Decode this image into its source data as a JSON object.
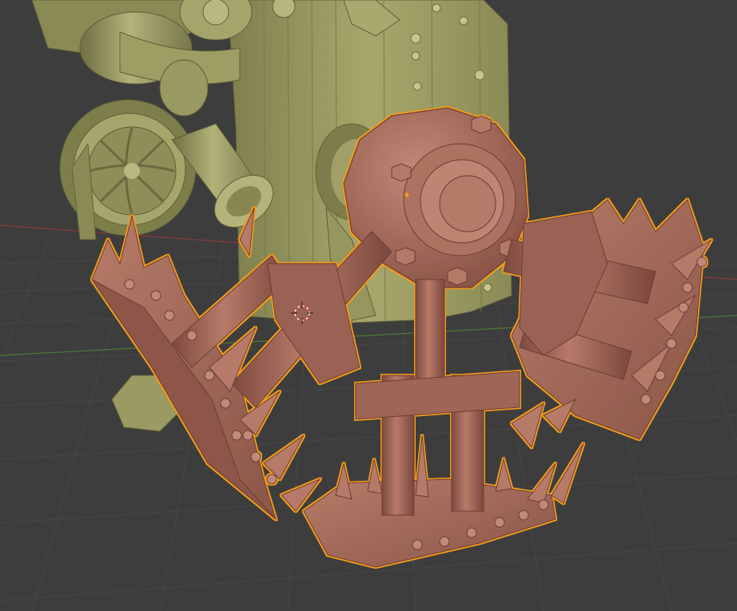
{
  "viewport": {
    "background_color": "#3d3d3d",
    "grid_color": "#474747",
    "x_axis_color": "#8c3a3f",
    "y_axis_color": "#4d7a35",
    "objects": [
      {
        "name": "background-model",
        "color": "#9a9a62",
        "selected": false
      },
      {
        "name": "selected-spiked-crown-model",
        "color": "#a86a5c",
        "selected": true,
        "outline_color": "#f29b1f"
      }
    ],
    "cursor_icon": "3d-cursor-icon"
  }
}
